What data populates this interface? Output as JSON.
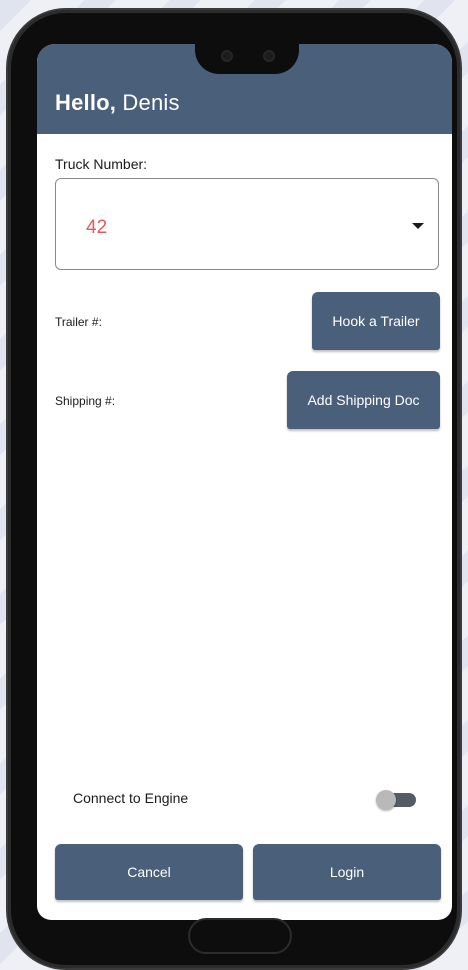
{
  "header": {
    "greeting": "Hello,",
    "user_name": "Denis"
  },
  "form": {
    "truck_label": "Truck Number:",
    "truck_value": "42",
    "trailer_label": "Trailer #:",
    "hook_trailer_label": "Hook a Trailer",
    "shipping_label": "Shipping #:",
    "add_shipping_label": "Add Shipping Doc",
    "engine_label": "Connect to Engine",
    "engine_connected": false
  },
  "actions": {
    "cancel_label": "Cancel",
    "login_label": "Login"
  },
  "colors": {
    "header": "#4a5f79",
    "button": "#4a5f79",
    "truck_value": "#e25b5b"
  }
}
